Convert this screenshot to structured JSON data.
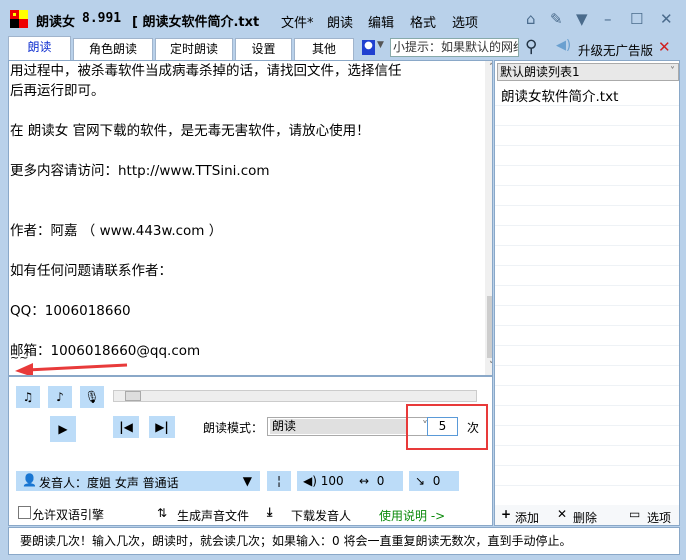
{
  "titlebar": {
    "app_name": "朗读女",
    "version": "8.991",
    "doc_title": "[ 朗读女软件简介.txt",
    "menu": [
      "文件*",
      "朗读",
      "编辑",
      "格式",
      "选项"
    ]
  },
  "tabs": [
    "朗读",
    "角色朗读",
    "定时朗读",
    "设置",
    "其他"
  ],
  "toolbar": {
    "hint": "小提示：如果默认的网络",
    "upgrade": "升级无广告版"
  },
  "editor": {
    "lines": [
      "用过程中，被杀毒软件当成病毒杀掉的话，请找回文件，选择信任",
      "后再运行即可。",
      "在 朗读女 官网下载的软件，是无毒无害软件，请放心使用！",
      "更多内容请访问：http://www.TTSini.com",
      "作者：阿嘉  （ www.443w.com ）",
      "如有任何问题请联系作者：",
      "QQ：1006018660",
      "邮箱：1006018660@qq.com",
      "~~"
    ]
  },
  "playlist": {
    "selected": "默认朗读列表1",
    "items": [
      "朗读女软件简介.txt"
    ],
    "add": "添加",
    "delete": "删除",
    "options": "选项"
  },
  "controls": {
    "mode_label": "朗读模式：",
    "mode_value": "朗读",
    "repeat_value": "5",
    "repeat_unit": "次",
    "speaker": "发音人：度姐 女声 普通话",
    "volume": "100",
    "speed": "0",
    "pitch": "0",
    "bilingual": "允许双语引擎",
    "gen_audio": "生成声音文件",
    "download_speaker": "下载发音人",
    "help": "使用说明 ->"
  },
  "status": "要朗读几次！输入几次，朗读时，就会读几次；如果输入：0 将会一直重复朗读无数次，直到手动停止。",
  "colors": {
    "accent": "#bcdcf8",
    "highlight": "#e83a3a",
    "help": "#0a8a0a"
  }
}
